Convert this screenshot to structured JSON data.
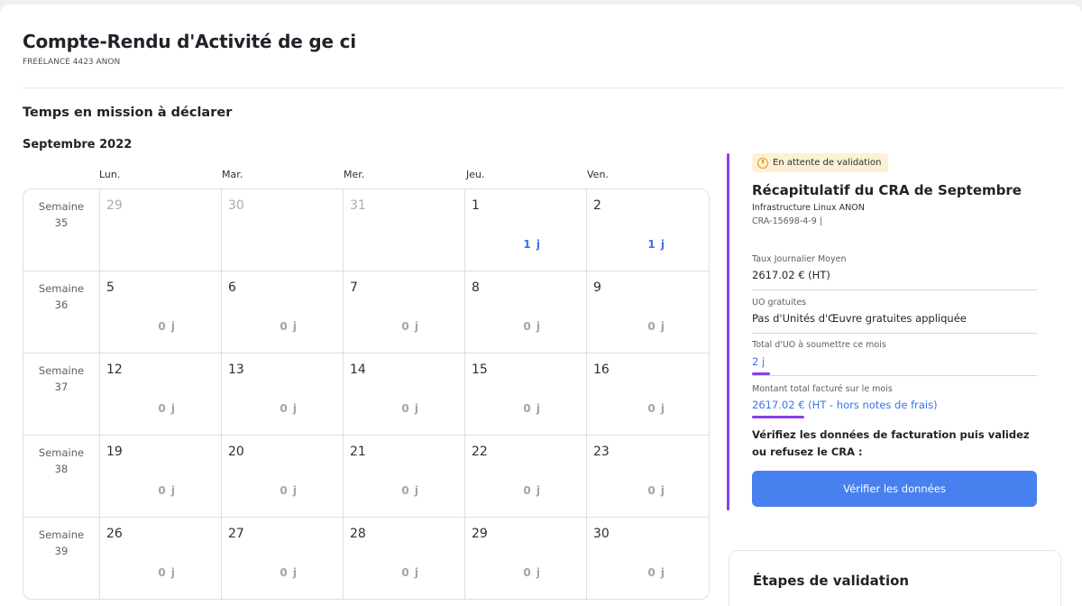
{
  "header": {
    "title": "Compte-Rendu d'Activité de ge ci",
    "subtitle": "FREELANCE 4423 ANON"
  },
  "section_title": "Temps en mission à déclarer",
  "month_title": "Septembre 2022",
  "day_headers": [
    "Lun.",
    "Mar.",
    "Mer.",
    "Jeu.",
    "Ven."
  ],
  "weeks": [
    {
      "label": "Semaine\n35",
      "days": [
        {
          "num": "29",
          "val": "",
          "other": true
        },
        {
          "num": "30",
          "val": "",
          "other": true
        },
        {
          "num": "31",
          "val": "",
          "other": true
        },
        {
          "num": "1",
          "val": "1 j",
          "active": true
        },
        {
          "num": "2",
          "val": "1 j",
          "active": true
        }
      ]
    },
    {
      "label": "Semaine\n36",
      "days": [
        {
          "num": "5",
          "val": "0 j"
        },
        {
          "num": "6",
          "val": "0 j"
        },
        {
          "num": "7",
          "val": "0 j"
        },
        {
          "num": "8",
          "val": "0 j"
        },
        {
          "num": "9",
          "val": "0 j"
        }
      ]
    },
    {
      "label": "Semaine\n37",
      "days": [
        {
          "num": "12",
          "val": "0 j"
        },
        {
          "num": "13",
          "val": "0 j"
        },
        {
          "num": "14",
          "val": "0 j"
        },
        {
          "num": "15",
          "val": "0 j"
        },
        {
          "num": "16",
          "val": "0 j"
        }
      ]
    },
    {
      "label": "Semaine\n38",
      "days": [
        {
          "num": "19",
          "val": "0 j"
        },
        {
          "num": "20",
          "val": "0 j"
        },
        {
          "num": "21",
          "val": "0 j"
        },
        {
          "num": "22",
          "val": "0 j"
        },
        {
          "num": "23",
          "val": "0 j"
        }
      ]
    },
    {
      "label": "Semaine\n39",
      "days": [
        {
          "num": "26",
          "val": "0 j"
        },
        {
          "num": "27",
          "val": "0 j"
        },
        {
          "num": "28",
          "val": "0 j"
        },
        {
          "num": "29",
          "val": "0 j"
        },
        {
          "num": "30",
          "val": "0 j"
        }
      ]
    }
  ],
  "recap": {
    "status": "En attente de validation",
    "status_icon": "clock-icon",
    "title": "Récapitulatif du CRA de Septembre",
    "mission": "Infrastructure Linux ANON",
    "reference": "CRA-15698-4-9 |",
    "tjm_label": "Taux Journalier Moyen",
    "tjm_value": "2617.02 € (HT)",
    "uo_label": "UO gratuites",
    "uo_value": "Pas d'Unités d'Œuvre gratuites appliquée",
    "total_uo_label": "Total d'UO à soumettre ce mois",
    "total_uo_value": "2 j",
    "amount_label": "Montant total facturé sur le mois",
    "amount_value": "2617.02 € (HT - hors notes de frais)",
    "verify_text": "Vérifiez les données de facturation puis validez ou refusez le CRA :",
    "verify_button": "Vérifier les données"
  },
  "steps": {
    "title": "Étapes de validation"
  },
  "colors": {
    "accent_purple": "#8b3ff0",
    "link_blue": "#3b73e8",
    "button_blue": "#4880f0",
    "badge_bg": "#fdf0d4"
  }
}
